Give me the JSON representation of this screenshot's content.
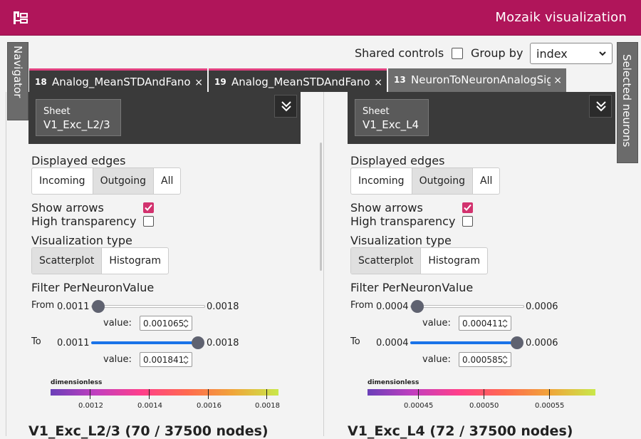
{
  "app": {
    "title": "Mozaik visualization"
  },
  "side": {
    "navigator": "Navigator",
    "selected": "Selected neurons"
  },
  "controls": {
    "shared_label": "Shared controls",
    "group_label": "Group by",
    "group_value": "index"
  },
  "tabs": [
    {
      "num": "18",
      "name": "Analog_MeanSTDAndFanoFactor",
      "close": "×"
    },
    {
      "num": "19",
      "name": "Analog_MeanSTDAndFanoFactor",
      "close": "×"
    },
    {
      "num": "13",
      "name": "NeuronToNeuronAnalogSignal",
      "close": "×"
    }
  ],
  "panels": [
    {
      "sheet_small": "Sheet",
      "sheet_name": "V1_Exc_L2/3",
      "edges_label": "Displayed edges",
      "edges": [
        "Incoming",
        "Outgoing",
        "All"
      ],
      "edges_selected": "Outgoing",
      "show_arrows": "Show arrows",
      "show_arrows_checked": true,
      "high_transparency": "High transparency",
      "high_transparency_checked": false,
      "vis_label": "Visualization type",
      "vis": [
        "Scatterplot",
        "Histogram"
      ],
      "vis_selected": "Scatterplot",
      "filter_label": "Filter PerNeuronValue",
      "from_label": "From",
      "to_label": "To",
      "value_label": "value:",
      "min": "0.0011",
      "max": "0.0018",
      "from_value": "0.001065",
      "to_value": "0.001841",
      "from_fraction": 0.0,
      "to_fraction": 1.0,
      "cbar_title": "dimensionless",
      "cbar_ticks": [
        "0.0012",
        "0.0014",
        "0.0016",
        "0.0018"
      ],
      "heading": "V1_Exc_L2/3 (70 / 37500 nodes)"
    },
    {
      "sheet_small": "Sheet",
      "sheet_name": "V1_Exc_L4",
      "edges_label": "Displayed edges",
      "edges": [
        "Incoming",
        "Outgoing",
        "All"
      ],
      "edges_selected": "Outgoing",
      "show_arrows": "Show arrows",
      "show_arrows_checked": true,
      "high_transparency": "High transparency",
      "high_transparency_checked": false,
      "vis_label": "Visualization type",
      "vis": [
        "Scatterplot",
        "Histogram"
      ],
      "vis_selected": "Scatterplot",
      "filter_label": "Filter PerNeuronValue",
      "from_label": "From",
      "to_label": "To",
      "value_label": "value:",
      "min": "0.0004",
      "max": "0.0006",
      "from_value": "0.000411",
      "to_value": "0.000585",
      "from_fraction": 0.0,
      "to_fraction": 1.0,
      "cbar_title": "dimensionless",
      "cbar_ticks": [
        "0.00045",
        "0.00050",
        "0.00055"
      ],
      "heading": "V1_Exc_L4 (72 / 37500 nodes)"
    }
  ],
  "colors": {
    "brand": "#b0155a",
    "accent": "#d2326e",
    "slider_fill": "#1a73e8"
  },
  "icons": {
    "logo": "sitemap-icon",
    "collapse": "double-chevron-down-icon",
    "select": "chevron-down-icon"
  }
}
